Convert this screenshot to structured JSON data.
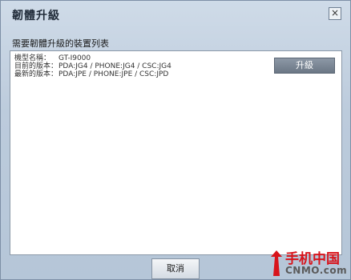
{
  "dialog": {
    "title": "韌體升級",
    "close_icon": "close-icon",
    "close_glyph": "×"
  },
  "section": {
    "label": "需要韌體升級的裝置列表"
  },
  "device": {
    "rows": [
      {
        "key": "機型名稱：",
        "value": "GT-I9000"
      },
      {
        "key": "目前的版本：",
        "value": "PDA:JG4 / PHONE:JG4 / CSC:JG4"
      },
      {
        "key": "最新的版本：",
        "value": "PDA:JPE / PHONE:JPE / CSC:JPD"
      }
    ]
  },
  "buttons": {
    "upgrade": "升級",
    "cancel": "取消"
  },
  "watermark": {
    "cn": "手机中国",
    "en": "CNMO.com",
    "logo_icon": "cnmo-logo-icon"
  }
}
